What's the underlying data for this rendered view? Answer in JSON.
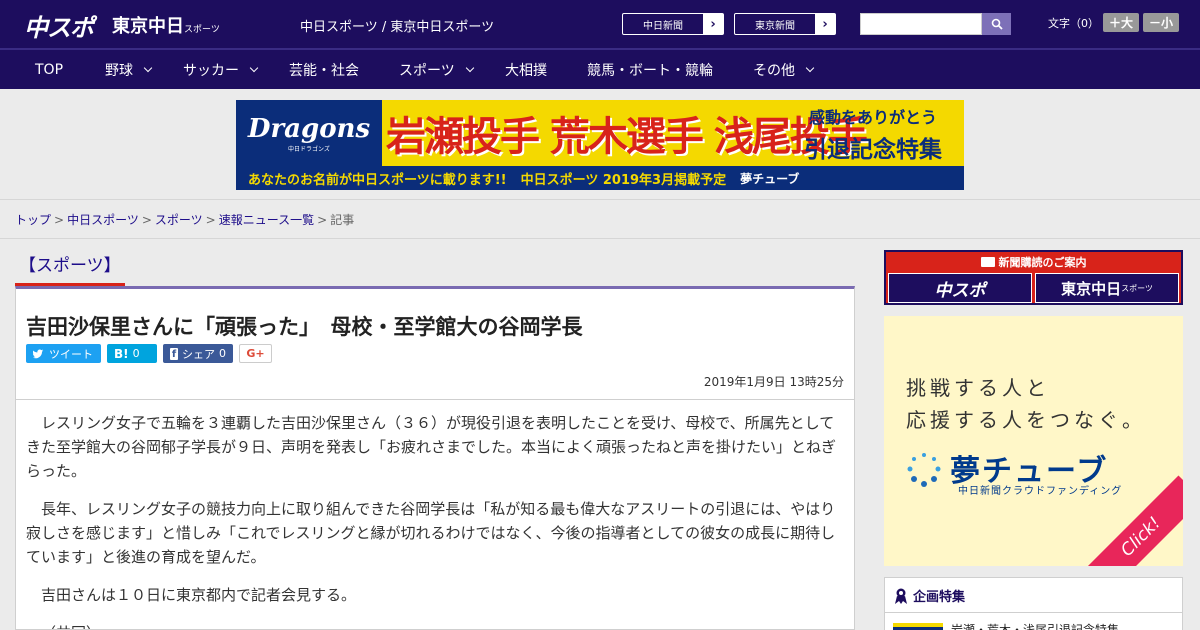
{
  "header": {
    "logo_chuspo": "中スポ",
    "logo_tokyo": "東京中日",
    "logo_tokyo_sub": "スポーツ",
    "site_title": "中日スポーツ / 東京中日スポーツ",
    "ext_links": [
      {
        "label": "中日新聞"
      },
      {
        "label": "東京新聞"
      }
    ],
    "search": {
      "value": "",
      "placeholder": ""
    },
    "font_size": {
      "label": "文字（0）",
      "bigger": "＋大",
      "smaller": "－小"
    }
  },
  "nav": {
    "items": [
      {
        "label": "TOP"
      },
      {
        "label": "野球"
      },
      {
        "label": "サッカー"
      },
      {
        "label": "芸能・社会"
      },
      {
        "label": "スポーツ"
      },
      {
        "label": "大相撲"
      },
      {
        "label": "競馬・ボート・競輪"
      },
      {
        "label": "その他"
      }
    ]
  },
  "banner": {
    "brand": "Dragons",
    "brand_sub": "中日ドラゴンズ",
    "players": "岩瀬投手 荒木選手 浅尾投手",
    "msg1": "感動をありがとう",
    "msg2": "引退記念特集",
    "bottom": "あなたのお名前が中日スポーツに載ります!!",
    "bottom2": "中日スポーツ 2019年3月掲載予定",
    "yume": "夢チューブ"
  },
  "breadcrumb": {
    "items": [
      "トップ",
      "中日スポーツ",
      "スポーツ",
      "速報ニュース一覧"
    ],
    "current": "記事"
  },
  "section_label": "【スポーツ】",
  "article": {
    "title": "吉田沙保里さんに「頑張った」　母校・至学館大の谷岡学長",
    "share": {
      "tweet": "ツイート",
      "hatena_count": "0",
      "facebook": "シェア",
      "facebook_count": "0"
    },
    "date": "2019年1月9日 13時25分",
    "paragraphs": [
      "レスリング女子で五輪を３連覇した吉田沙保里さん（３６）が現役引退を表明したことを受け、母校で、所属先としてきた至学館大の谷岡郁子学長が９日、声明を発表し「お疲れさまでした。本当によく頑張ったねと声を掛けたい」とねぎらった。",
      "長年、レスリング女子の競技力向上に取り組んできた谷岡学長は「私が知る最も偉大なアスリートの引退には、やはり寂しさを感じます」と惜しみ「これでレスリングと縁が切れるわけではなく、今後の指導者としての彼女の成長に期待しています」と後進の育成を望んだ。",
      "吉田さんは１０日に東京都内で記者会見する。",
      "（共同）"
    ]
  },
  "sidebar": {
    "subscribe_title": "新聞購読のご案内",
    "sub_a": "中スポ",
    "sub_b": "東京中日",
    "sub_b_small": "スポーツ",
    "ad": {
      "line1": "挑戦する人と",
      "line2": "応援する人をつなぐ。",
      "logo": "夢チューブ",
      "sub": "中日新聞クラウドファンディング",
      "click": "Click!"
    },
    "special_title": "企画特集",
    "special_item": "岩瀬・荒木・浅尾引退記念特集"
  },
  "colors": {
    "header_bg": "#1d0d5e",
    "accent_red": "#d8231a",
    "link": "#1d0d8a"
  }
}
